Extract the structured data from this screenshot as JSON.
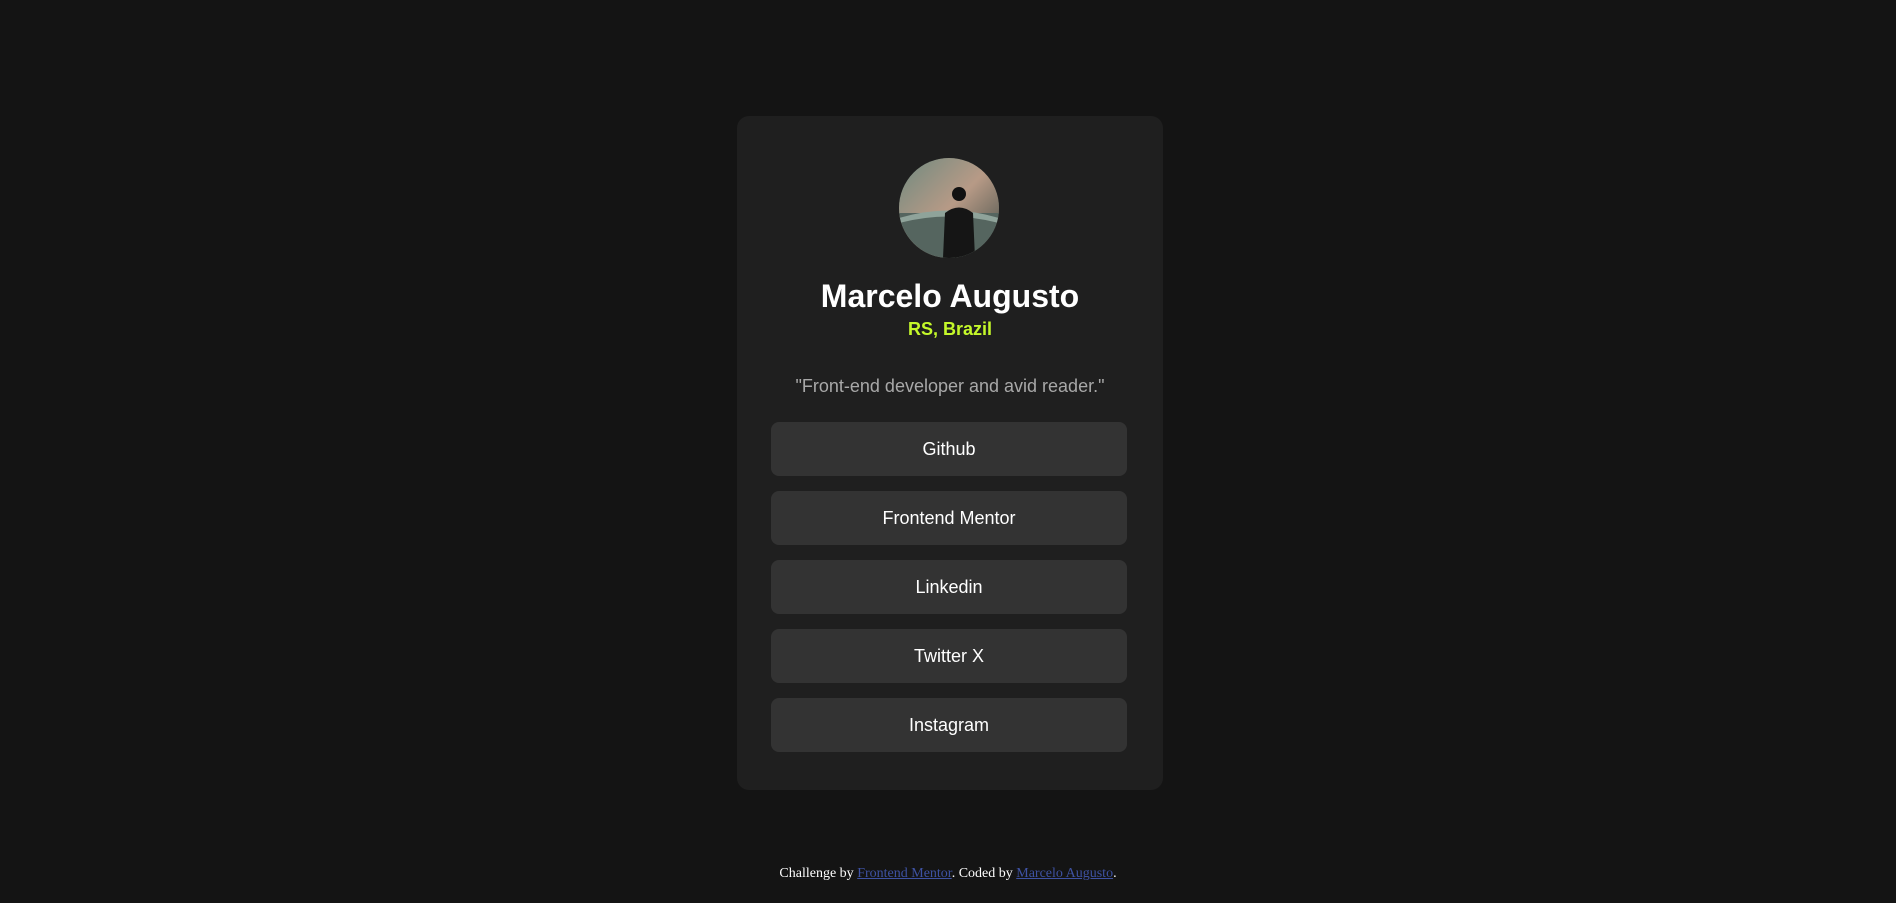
{
  "profile": {
    "avatar_alt": "profile photo",
    "name": "Marcelo Augusto",
    "location": "RS, Brazil",
    "bio": "\"Front-end developer and avid reader.\""
  },
  "links": [
    {
      "label": "Github"
    },
    {
      "label": "Frontend Mentor"
    },
    {
      "label": "Linkedin"
    },
    {
      "label": "Twitter X"
    },
    {
      "label": "Instagram"
    }
  ],
  "footer": {
    "prefix": "Challenge by ",
    "challenge_link": "Frontend Mentor",
    "middle": ". Coded by ",
    "author_link": "Marcelo Augusto",
    "suffix": "."
  },
  "colors": {
    "background": "#141414",
    "card": "#1f1f1f",
    "button": "#333333",
    "accent": "#c4f82a",
    "muted": "#a8a8a8",
    "link": "#3e52a3"
  }
}
